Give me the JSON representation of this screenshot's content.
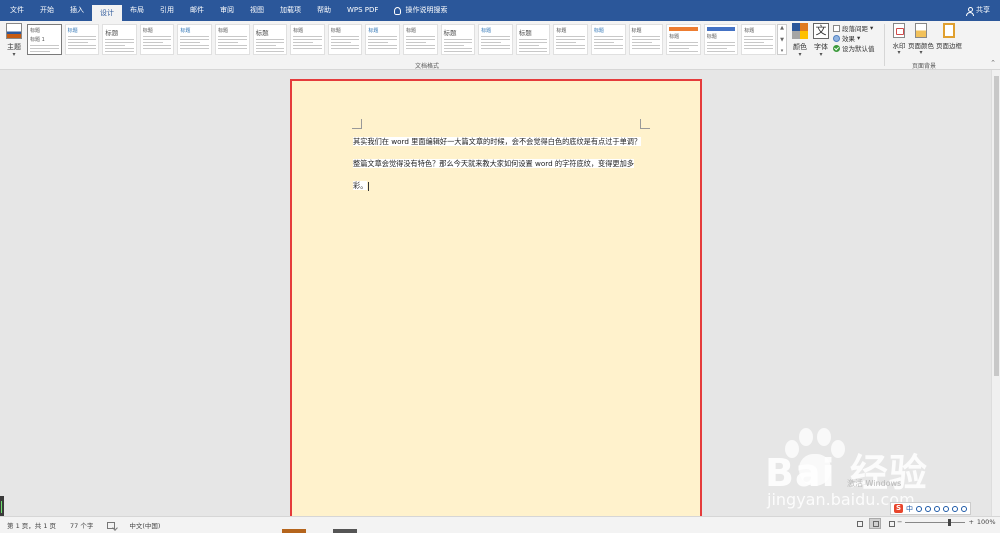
{
  "tabs": [
    {
      "label": "文件"
    },
    {
      "label": "开始"
    },
    {
      "label": "插入"
    },
    {
      "label": "设计",
      "active": true
    },
    {
      "label": "布局"
    },
    {
      "label": "引用"
    },
    {
      "label": "邮件"
    },
    {
      "label": "审阅"
    },
    {
      "label": "视图"
    },
    {
      "label": "加载项"
    },
    {
      "label": "帮助"
    },
    {
      "label": "WPS PDF"
    }
  ],
  "search": {
    "label": "操作说明搜索",
    "icon": "lightbulb-icon"
  },
  "share": {
    "label": "共享",
    "icon": "person-icon"
  },
  "ribbon": {
    "theme_label": "主题",
    "gallery": [
      {
        "title": "标题",
        "selected": true,
        "sample": "标题 1"
      },
      {
        "title": "标题"
      },
      {
        "title": "标题"
      },
      {
        "title": "标题"
      },
      {
        "title": "标题"
      },
      {
        "title": "标题"
      },
      {
        "title": "标题"
      },
      {
        "title": "标题"
      },
      {
        "title": "标题"
      },
      {
        "title": "标题"
      },
      {
        "title": "标题"
      },
      {
        "title": "标题"
      },
      {
        "title": "标题"
      },
      {
        "title": "标题"
      },
      {
        "title": "标题"
      },
      {
        "title": "标题"
      },
      {
        "title": "标题"
      },
      {
        "title": "标题"
      },
      {
        "title": "标题"
      },
      {
        "title": "标题"
      }
    ],
    "document_formatting_label": "文档格式",
    "colors_label": "颜色",
    "fonts_label": "字体",
    "paragraph_spacing_label": "段落间距",
    "effects_label": "效果",
    "set_default_label": "设为默认值",
    "watermark_label": "水印",
    "page_color_label": "页面颜色",
    "page_borders_label": "页面边框",
    "page_background_label": "页面背景",
    "accent_colors": [
      "#2b579a",
      "#e07a1f",
      "#a5a5a5",
      "#ffc000"
    ]
  },
  "document": {
    "page_color": "#fff2cc",
    "lines": [
      "其实我们在 word 里面编辑好一大篇文章的时候，会不会觉得白色的底纹是有点过于单调？",
      "整篇文章会觉得没有特色？那么今天就来教大家如何设置 word 的字符底纹，变得更加多",
      "彩。"
    ]
  },
  "status": {
    "page": "第 1 页，共 1 页",
    "words": "77 个字",
    "language": "中文(中国)",
    "zoom": "100%"
  },
  "ime": {
    "label": "中",
    "brand": "S"
  },
  "watermark": {
    "brand": "Bai 经验",
    "url": "jingyan.baidu.com",
    "activate": "激活 Windows"
  }
}
